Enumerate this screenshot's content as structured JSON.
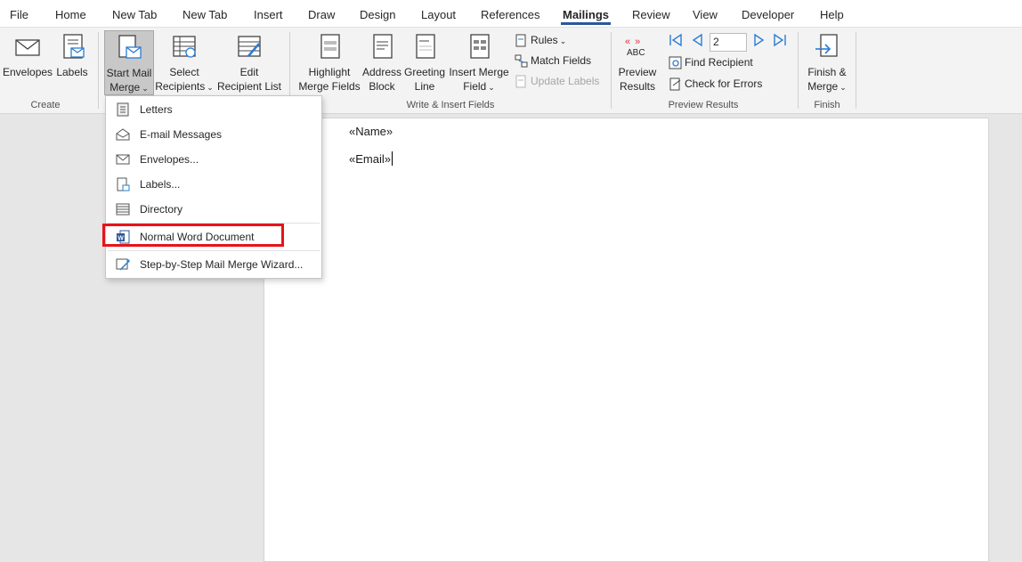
{
  "tabs": [
    "File",
    "Home",
    "New Tab",
    "New Tab",
    "Insert",
    "Draw",
    "Design",
    "Layout",
    "References",
    "Mailings",
    "Review",
    "View",
    "Developer",
    "Help"
  ],
  "active_tab": "Mailings",
  "ribbon": {
    "create": {
      "label": "Create",
      "envelopes": "Envelopes",
      "labels": "Labels"
    },
    "start": {
      "start_mail_merge": [
        "Start Mail",
        "Merge"
      ],
      "select_recipients": [
        "Select",
        "Recipients"
      ],
      "edit_recipient_list": [
        "Edit",
        "Recipient List"
      ]
    },
    "write_insert": {
      "label": "Write & Insert Fields",
      "highlight": [
        "Highlight",
        "Merge Fields"
      ],
      "address_block": [
        "Address",
        "Block"
      ],
      "greeting_line": [
        "Greeting",
        "Line"
      ],
      "insert_merge_field": [
        "Insert Merge",
        "Field"
      ],
      "rules": "Rules",
      "match_fields": "Match Fields",
      "update_labels": "Update Labels"
    },
    "preview": {
      "label": "Preview Results",
      "preview_results": [
        "Preview",
        "Results"
      ],
      "abc": "ABC",
      "record": "2",
      "find_recipient": "Find Recipient",
      "check_errors": "Check for Errors"
    },
    "finish": {
      "label": "Finish",
      "finish_merge": [
        "Finish &",
        "Merge"
      ]
    }
  },
  "document": {
    "field_name": "«Name»",
    "field_email": "«Email»"
  },
  "menu": {
    "items": [
      "Letters",
      "E-mail Messages",
      "Envelopes...",
      "Labels...",
      "Directory",
      "Normal Word Document",
      "Step-by-Step Mail Merge Wizard..."
    ],
    "highlighted": "Normal Word Document"
  },
  "colors": {
    "accent": "#2b579a",
    "highlight_box": "#e8131b",
    "nav_arrows": "#2b7cd3",
    "preview_arrows": "#d9373c"
  }
}
